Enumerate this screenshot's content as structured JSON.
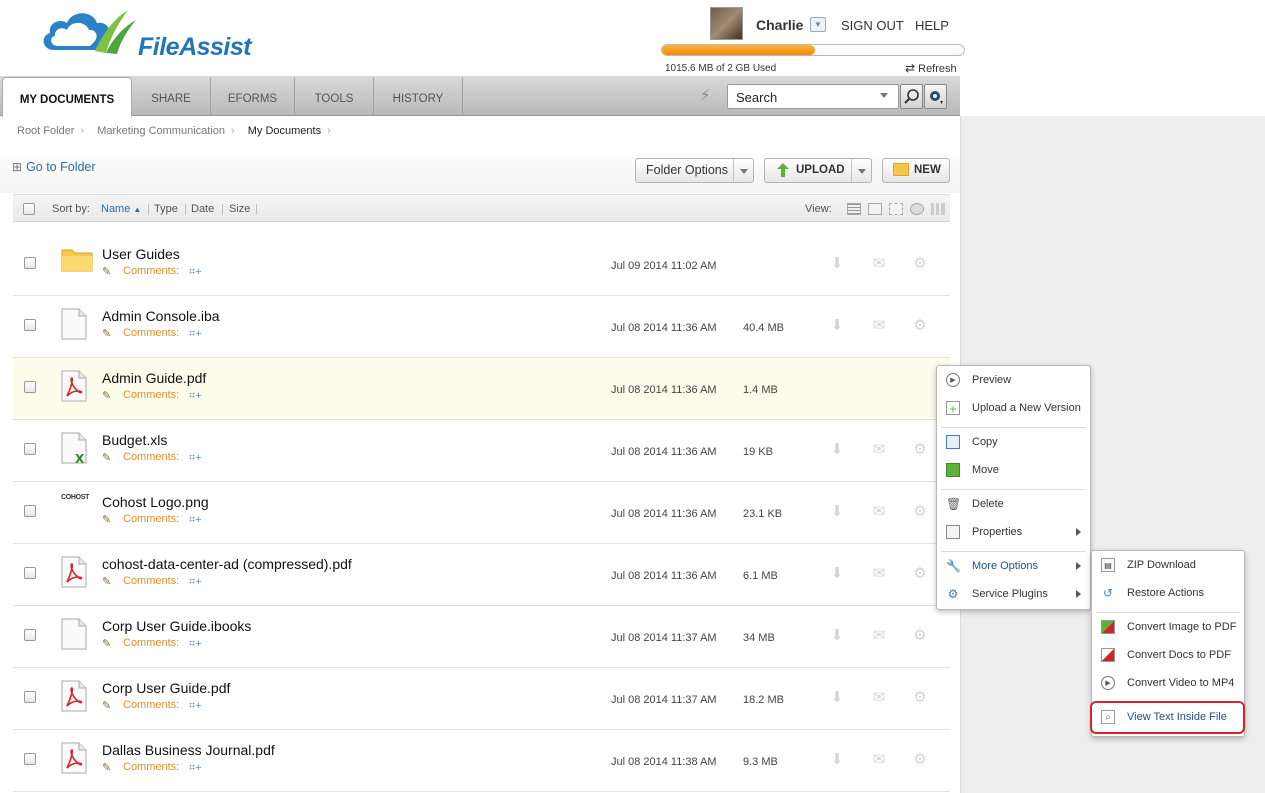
{
  "app": {
    "name": "FileAssist"
  },
  "user": {
    "name": "Charlie",
    "sign_out": "SIGN OUT",
    "help": "HELP"
  },
  "quota": {
    "text": "1015.6 MB of 2 GB Used",
    "fraction": 0.5078,
    "refresh": "Refresh"
  },
  "tabs": [
    {
      "label": "MY DOCUMENTS",
      "active": true
    },
    {
      "label": "SHARE",
      "active": false
    },
    {
      "label": "EFORMS",
      "active": false
    },
    {
      "label": "TOOLS",
      "active": false
    },
    {
      "label": "HISTORY",
      "active": false
    }
  ],
  "search": {
    "value": "Search"
  },
  "breadcrumb": [
    "Root Folder",
    "Marketing Communication",
    "My Documents"
  ],
  "toolbar": {
    "goto": "Go to Folder",
    "folder_options": "Folder Options",
    "upload": "UPLOAD",
    "new": "NEW"
  },
  "sort": {
    "label": "Sort by:",
    "name": "Name",
    "type": "Type",
    "date": "Date",
    "size": "Size",
    "view": "View:"
  },
  "files": [
    {
      "name": "User Guides",
      "kind": "folder",
      "comments": "Comments:",
      "date": "Jul 09 2014 11:02 AM",
      "size": ""
    },
    {
      "name": "Admin Console.iba",
      "kind": "doc",
      "comments": "Comments:",
      "date": "Jul 08 2014 11:36 AM",
      "size": "40.4 MB"
    },
    {
      "name": "Admin Guide.pdf",
      "kind": "pdf",
      "comments": "Comments:",
      "date": "Jul 08 2014 11:36 AM",
      "size": "1.4 MB"
    },
    {
      "name": "Budget.xls",
      "kind": "xls",
      "comments": "Comments:",
      "date": "Jul 08 2014 11:36 AM",
      "size": "19 KB"
    },
    {
      "name": "Cohost Logo.png",
      "kind": "img",
      "comments": "Comments:",
      "date": "Jul 08 2014 11:36 AM",
      "size": "23.1 KB"
    },
    {
      "name": "cohost-data-center-ad (compressed).pdf",
      "kind": "pdf",
      "comments": "Comments:",
      "date": "Jul 08 2014 11:36 AM",
      "size": "6.1 MB"
    },
    {
      "name": "Corp User Guide.ibooks",
      "kind": "doc",
      "comments": "Comments:",
      "date": "Jul 08 2014 11:37 AM",
      "size": "34 MB"
    },
    {
      "name": "Corp User Guide.pdf",
      "kind": "pdf",
      "comments": "Comments:",
      "date": "Jul 08 2014 11:37 AM",
      "size": "18.2 MB"
    },
    {
      "name": "Dallas Business Journal.pdf",
      "kind": "pdf",
      "comments": "Comments:",
      "date": "Jul 08 2014 11:38 AM",
      "size": "9.3 MB"
    }
  ],
  "context_menu": [
    {
      "label": "Preview",
      "icon": "play-circle-icon"
    },
    {
      "label": "Upload a New Version",
      "icon": "upload-version-icon"
    },
    {
      "label": "Copy",
      "icon": "copy-icon"
    },
    {
      "label": "Move",
      "icon": "move-icon"
    },
    {
      "label": "Delete",
      "icon": "trash-icon"
    },
    {
      "label": "Properties",
      "icon": "properties-icon",
      "submenu": true
    },
    {
      "label": "More Options",
      "icon": "wrench-icon",
      "submenu": true
    },
    {
      "label": "Service Plugins",
      "icon": "plugin-icon",
      "submenu": true
    }
  ],
  "submenu": [
    {
      "label": "ZIP Download",
      "icon": "zip-icon"
    },
    {
      "label": "Restore Actions",
      "icon": "restore-icon"
    },
    {
      "label": "Convert Image to PDF",
      "icon": "image-pdf-icon"
    },
    {
      "label": "Convert Docs to PDF",
      "icon": "doc-pdf-icon"
    },
    {
      "label": "Convert Video to MP4",
      "icon": "video-icon"
    },
    {
      "label": "View Text Inside File",
      "icon": "magnifier-doc-icon"
    }
  ],
  "cohost_logo_text": "COHOST",
  "colors": {
    "brand_blue": "#2175bd",
    "quota_orange": "#f28a00",
    "highlight_red": "#d6232a"
  }
}
